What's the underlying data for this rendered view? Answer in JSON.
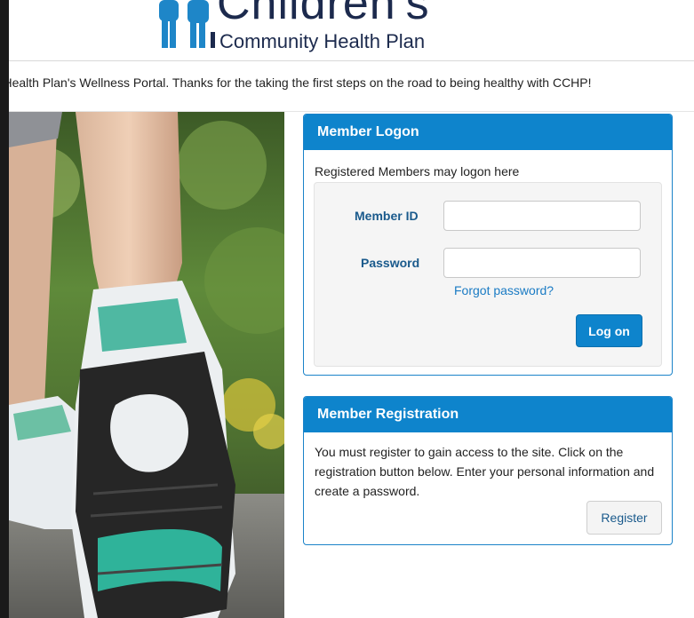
{
  "header": {
    "logo_big": "Children's",
    "logo_sub": "Community Health Plan"
  },
  "welcome_text": "unity Health Plan's Wellness Portal. Thanks for the taking the first steps on the road to being healthy with CCHP!",
  "hero_image": "person-walking-sneakers",
  "logon": {
    "title": "Member Logon",
    "intro": "Registered Members may logon here",
    "member_id_label": "Member ID",
    "member_id_value": "",
    "password_label": "Password",
    "password_value": "",
    "forgot_link": "Forgot password?",
    "submit_label": "Log on"
  },
  "registration": {
    "title": "Member Registration",
    "description": "You must register to gain access to the site. Click on the registration button below. Enter your personal information and create a password.",
    "button_label": "Register"
  },
  "colors": {
    "accent": "#0e84cc",
    "label_blue": "#1a5a8c",
    "link_blue": "#1a7bc4",
    "logo_navy": "#1c2a4d"
  }
}
